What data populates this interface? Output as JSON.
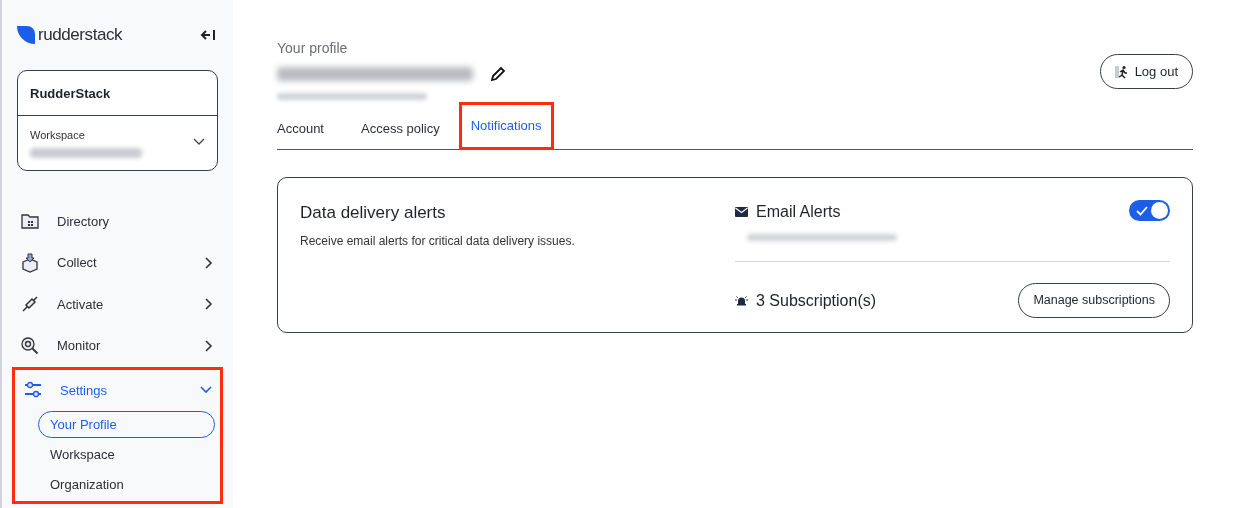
{
  "sidebar": {
    "logo_text": "rudderstack",
    "organization": "RudderStack",
    "workspace_label": "Workspace",
    "nav": [
      {
        "label": "Directory",
        "has_submenu": false,
        "expanded": false,
        "highlighted": false
      },
      {
        "label": "Collect",
        "has_submenu": true,
        "expanded": false,
        "highlighted": false
      },
      {
        "label": "Activate",
        "has_submenu": true,
        "expanded": false,
        "highlighted": false
      },
      {
        "label": "Monitor",
        "has_submenu": true,
        "expanded": false,
        "highlighted": false
      },
      {
        "label": "Settings",
        "has_submenu": true,
        "expanded": true,
        "highlighted": true,
        "children": [
          {
            "label": "Your Profile",
            "selected": true
          },
          {
            "label": "Workspace",
            "selected": false
          },
          {
            "label": "Organization",
            "selected": false
          }
        ]
      }
    ]
  },
  "header": {
    "title": "Your profile",
    "logout": "Log out"
  },
  "tabs": [
    {
      "label": "Account",
      "selected": false,
      "highlighted": false
    },
    {
      "label": "Access policy",
      "selected": false,
      "highlighted": false
    },
    {
      "label": "Notifications",
      "selected": true,
      "highlighted": true
    }
  ],
  "card": {
    "title": "Data delivery alerts",
    "description": "Receive email alerts for critical data delivery issues.",
    "email_alerts": {
      "label": "Email Alerts",
      "on": true
    },
    "subscriptions": {
      "label": "3 Subscription(s)",
      "button": "Manage subscriptions"
    }
  }
}
